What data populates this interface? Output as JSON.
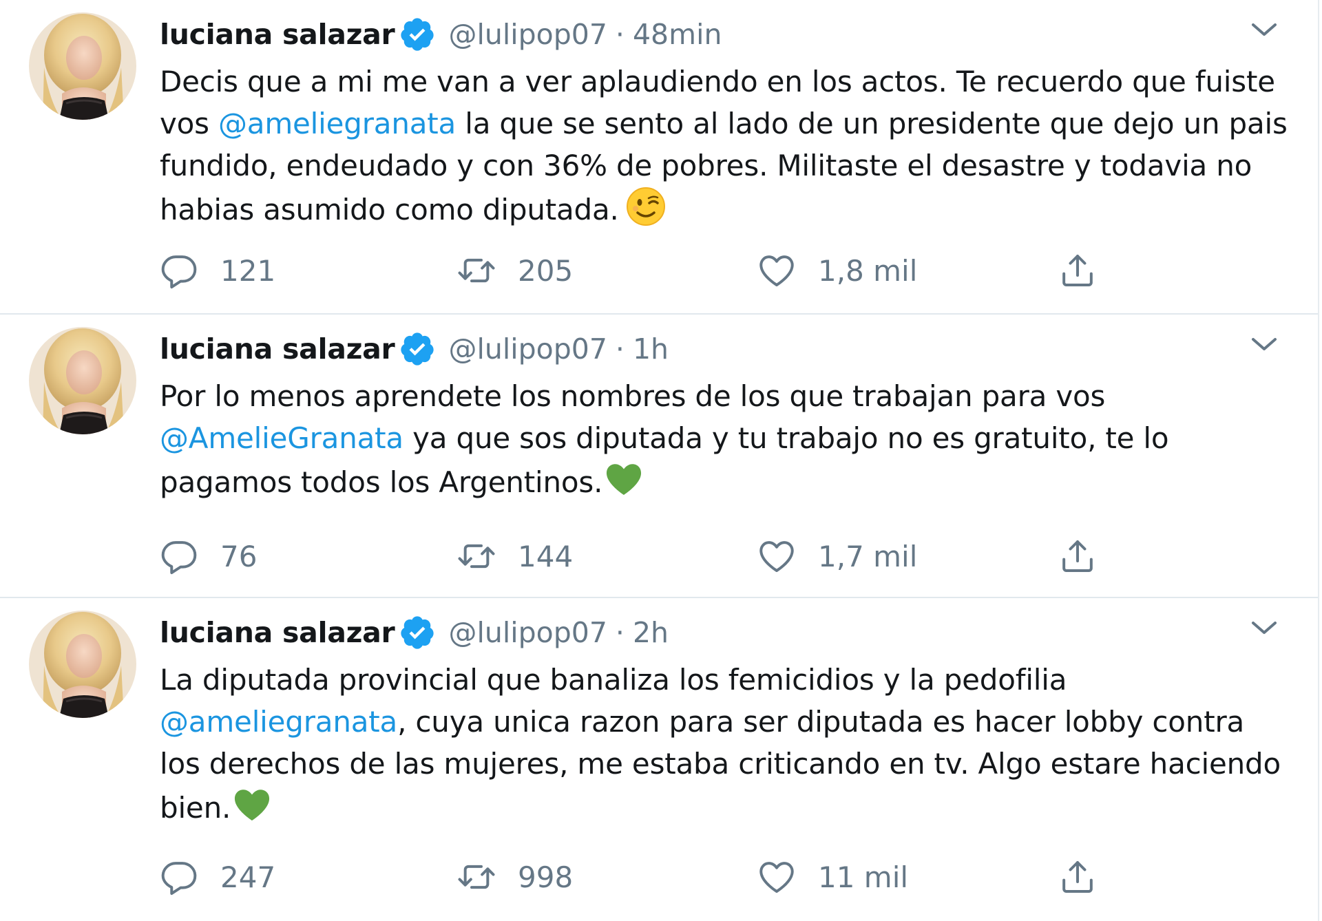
{
  "tweets": [
    {
      "author_name": "luciana salazar",
      "handle": "@lulipop07",
      "separator": "·",
      "time": "48min",
      "text_parts": [
        "Decis que a mi me van a ver aplaudiendo en los actos. Te recuerdo que fuiste vos ",
        "@ameliegranata",
        " la que se sento al lado de un presidente que dejo un pais fundido, endeudado y con 36% de pobres. Militaste el desastre y todavia no habias asumido como diputada."
      ],
      "emoji": "wink-emoji",
      "replies": "121",
      "retweets": "205",
      "likes": "1,8 mil"
    },
    {
      "author_name": "luciana salazar",
      "handle": "@lulipop07",
      "separator": "·",
      "time": "1h",
      "text_parts": [
        "Por lo menos aprendete los nombres de los que trabajan para vos ",
        "@AmelieGranata",
        " ya que sos diputada y tu trabajo no es gratuito, te lo pagamos todos los Argentinos."
      ],
      "emoji": "green-heart-emoji",
      "replies": "76",
      "retweets": "144",
      "likes": "1,7 mil"
    },
    {
      "author_name": "luciana salazar",
      "handle": "@lulipop07",
      "separator": "·",
      "time": "2h",
      "text_parts": [
        "La diputada provincial que banaliza los femicidios y la pedofilia ",
        "@ameliegranata",
        ", cuya unica razon para ser diputada es hacer lobby contra los derechos de las mujeres, me estaba criticando en tv. Algo estare haciendo bien."
      ],
      "emoji": "green-heart-emoji",
      "replies": "247",
      "retweets": "998",
      "likes": "11 mil"
    }
  ],
  "colors": {
    "text": "#14171a",
    "secondary": "#657786",
    "mention": "#1b95e0",
    "verified": "#1da1f2",
    "divider": "#e1e8ed"
  },
  "icons": {
    "reply": "reply-icon",
    "retweet": "retweet-icon",
    "like": "like-icon",
    "share": "share-icon",
    "more": "chevron-down-icon",
    "verified": "verified-badge-icon"
  }
}
